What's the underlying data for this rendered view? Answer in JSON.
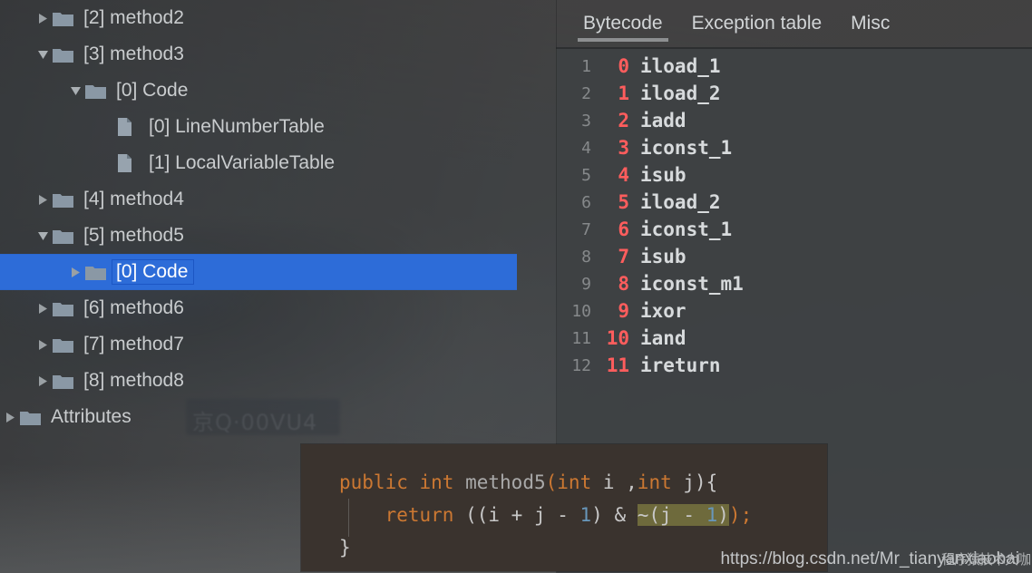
{
  "colors": {
    "selection_blue": "#2d6cd8",
    "folder_icon": "#8a98a5",
    "file_icon": "#97a3ae",
    "offset_red": "#ff5d5d",
    "keyword_orange": "#cc7832",
    "number_blue": "#6897bb",
    "highlight_olive": "#6e6a3c",
    "panel_bg": "#3e4143"
  },
  "tree": {
    "items": [
      {
        "arrow": "collapsed",
        "icon": "folder-icon",
        "label": "[2] method2",
        "indent": 1,
        "selected": false
      },
      {
        "arrow": "expanded",
        "icon": "folder-icon",
        "label": "[3] method3",
        "indent": 1,
        "selected": false
      },
      {
        "arrow": "expanded",
        "icon": "folder-icon",
        "label": "[0] Code",
        "indent": 2,
        "selected": false
      },
      {
        "arrow": "none",
        "icon": "file-icon",
        "label": "[0] LineNumberTable",
        "indent": 3,
        "selected": false
      },
      {
        "arrow": "none",
        "icon": "file-icon",
        "label": "[1] LocalVariableTable",
        "indent": 3,
        "selected": false
      },
      {
        "arrow": "collapsed",
        "icon": "folder-icon",
        "label": "[4] method4",
        "indent": 1,
        "selected": false
      },
      {
        "arrow": "expanded",
        "icon": "folder-icon",
        "label": "[5] method5",
        "indent": 1,
        "selected": false
      },
      {
        "arrow": "collapsed",
        "icon": "folder-icon",
        "label": "[0] Code",
        "indent": 2,
        "selected": true
      },
      {
        "arrow": "collapsed",
        "icon": "folder-icon",
        "label": "[6] method6",
        "indent": 1,
        "selected": false
      },
      {
        "arrow": "collapsed",
        "icon": "folder-icon",
        "label": "[7] method7",
        "indent": 1,
        "selected": false
      },
      {
        "arrow": "collapsed",
        "icon": "folder-icon",
        "label": "[8] method8",
        "indent": 1,
        "selected": false
      },
      {
        "arrow": "collapsed",
        "icon": "folder-icon",
        "label": "Attributes",
        "indent": 0,
        "selected": false
      }
    ]
  },
  "tabs": [
    {
      "label": "Bytecode",
      "active": true
    },
    {
      "label": "Exception table",
      "active": false
    },
    {
      "label": "Misc",
      "active": false
    }
  ],
  "bytecode": {
    "lines": [
      {
        "line": "1",
        "offset": "0",
        "op": "iload_1"
      },
      {
        "line": "2",
        "offset": "1",
        "op": "iload_2"
      },
      {
        "line": "3",
        "offset": "2",
        "op": "iadd"
      },
      {
        "line": "4",
        "offset": "3",
        "op": "iconst_1"
      },
      {
        "line": "5",
        "offset": "4",
        "op": "isub"
      },
      {
        "line": "6",
        "offset": "5",
        "op": "iload_2"
      },
      {
        "line": "7",
        "offset": "6",
        "op": "iconst_1"
      },
      {
        "line": "8",
        "offset": "7",
        "op": "isub"
      },
      {
        "line": "9",
        "offset": "8",
        "op": "iconst_m1"
      },
      {
        "line": "10",
        "offset": "9",
        "op": "ixor"
      },
      {
        "line": "11",
        "offset": "10",
        "op": "iand"
      },
      {
        "line": "12",
        "offset": "11",
        "op": "ireturn"
      }
    ]
  },
  "code_overlay": {
    "line1": {
      "kw_public": "public",
      "kw_int": "int",
      "method_name": "method5",
      "paren_open": "(",
      "kw_int2": "int",
      "param_i": " i ,",
      "kw_int3": "int",
      "param_j": " j){"
    },
    "line2": {
      "kw_return": "return",
      "expr_a": " ((i + j - ",
      "num1": "1",
      "expr_b": ") & ",
      "hl_open": "~(j - ",
      "hl_num": "1",
      "hl_close": ")",
      "tail": ");"
    },
    "line3": "}"
  },
  "watermark": {
    "url": "https://blog.csdn.net/Mr_tianyanxiaobai",
    "cn": "程序猿技术大咖"
  },
  "background": {
    "plate_text": "京Q·00VU4"
  }
}
